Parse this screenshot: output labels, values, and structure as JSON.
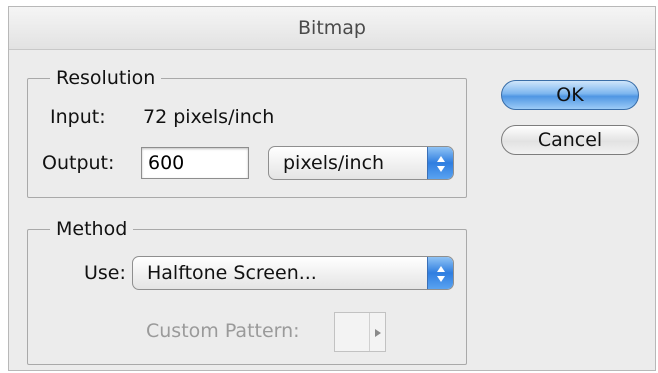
{
  "window": {
    "title": "Bitmap"
  },
  "resolution": {
    "group_label": "Resolution",
    "input_label": "Input:",
    "input_value": "72 pixels/inch",
    "output_label": "Output:",
    "output_value": "600",
    "unit_selected": "pixels/inch"
  },
  "method": {
    "group_label": "Method",
    "use_label": "Use:",
    "use_selected": "Halftone Screen...",
    "custom_pattern_label": "Custom Pattern:"
  },
  "buttons": {
    "ok_label": "OK",
    "cancel_label": "Cancel"
  },
  "colors": {
    "accent": "#4f96e3",
    "dialog_bg": "#ececec"
  },
  "icons": {
    "popup_arrows": "up-down-arrows-icon",
    "pattern_arrow": "triangle-right-icon"
  }
}
